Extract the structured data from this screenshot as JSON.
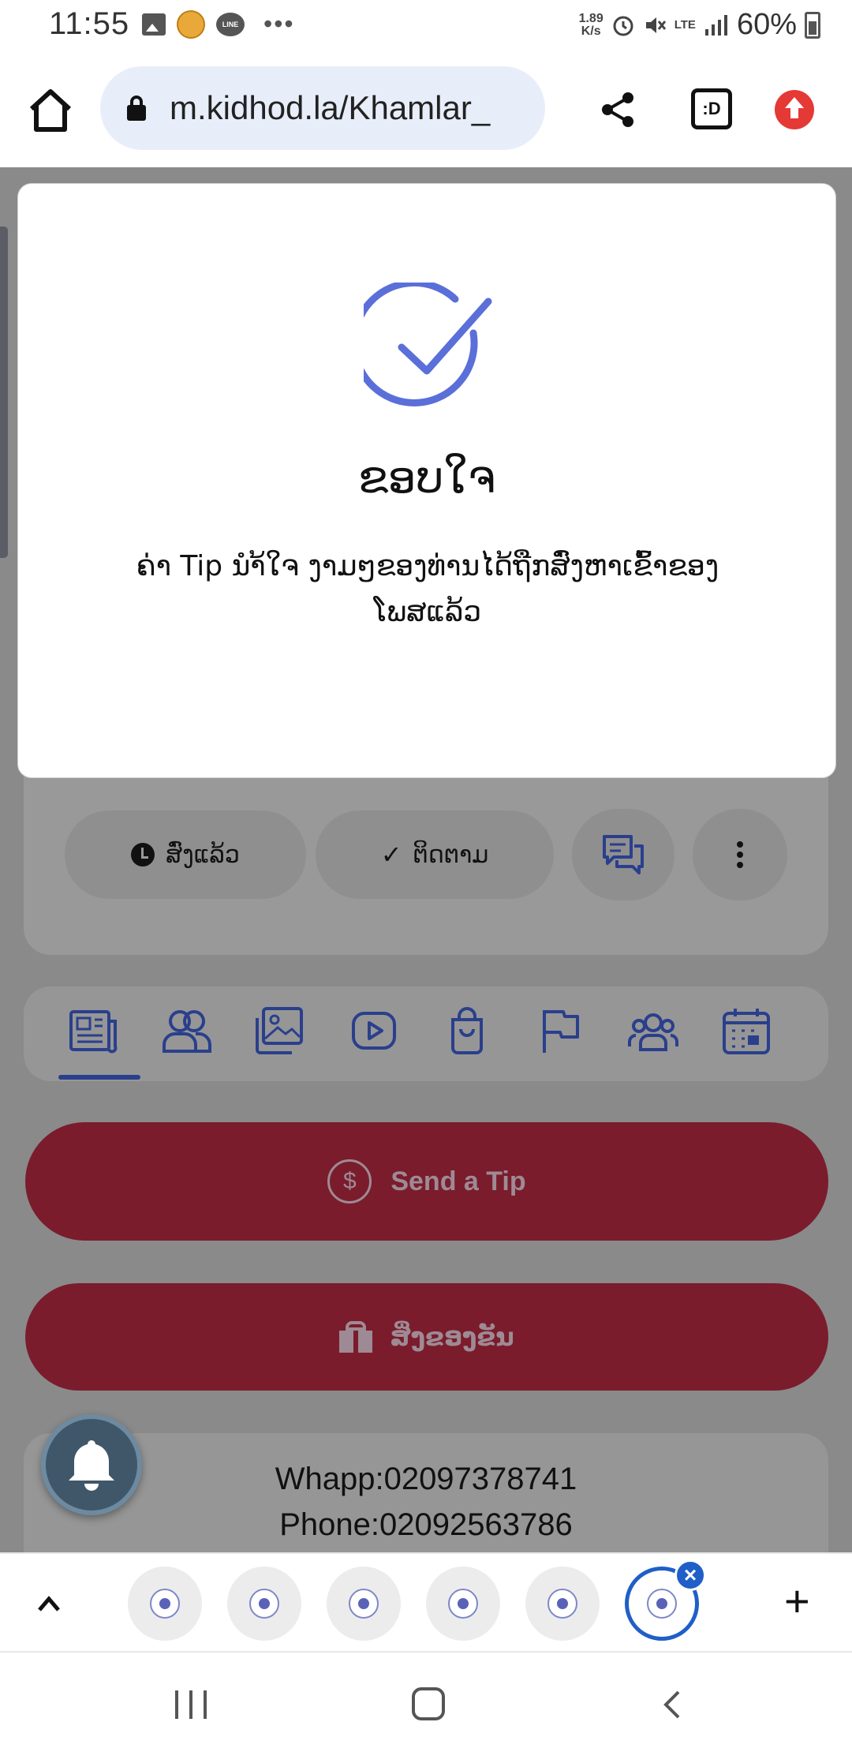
{
  "status_bar": {
    "time": "11:55",
    "line_app_label": "LINE",
    "more": "•••",
    "net_speed_value": "1.89",
    "net_speed_unit": "K/s",
    "network": "LTE",
    "battery": "60%"
  },
  "browser": {
    "url": "m.kidhod.la/Khamlar_",
    "tab_count_label": ":D"
  },
  "modal": {
    "title": "ຂອບໃຈ",
    "message": "ຄ່າ Tip ນຳ້ໃຈ ງາມໆຂອງທ່ານໄດ້ຖືກສົ່ງຫາເຂົ້າຂອງ ໂພສແລ້ວ"
  },
  "profile_actions": {
    "sent_label": "ສົ່ງແລ້ວ",
    "follow_label": "ຕິດຕາມ"
  },
  "buttons": {
    "send_tip": "Send a Tip",
    "dollar_symbol": "$",
    "gift": "ສິ່ງຂອງຂັນ"
  },
  "contact": {
    "whatsapp": "Whapp:02097378741",
    "phone": "Phone:02092563786"
  },
  "tab_strip": {
    "add_label": "+",
    "close_symbol": "×"
  }
}
